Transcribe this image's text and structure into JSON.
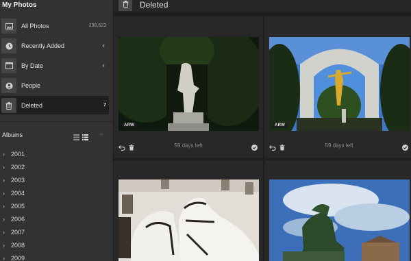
{
  "sidebar": {
    "title": "My Photos",
    "nav": [
      {
        "label": "All Photos",
        "count": "298,623",
        "icon": "image-icon"
      },
      {
        "label": "Recently Added",
        "count": "",
        "icon": "clock-icon"
      },
      {
        "label": "By Date",
        "count": "",
        "icon": "calendar-icon"
      },
      {
        "label": "People",
        "count": "",
        "icon": "person-icon"
      },
      {
        "label": "Deleted",
        "count": "7",
        "icon": "trash-icon"
      }
    ],
    "albums_title": "Albums",
    "years": [
      "2001",
      "2002",
      "2003",
      "2004",
      "2005",
      "2006",
      "2007",
      "2008",
      "2009"
    ]
  },
  "toolbar": {
    "title": "Deleted"
  },
  "photos": [
    {
      "format": "ARW",
      "days_left": "59 days left"
    },
    {
      "format": "ARW",
      "days_left": "59 days left"
    },
    {
      "format": "",
      "days_left": ""
    },
    {
      "format": "",
      "days_left": ""
    }
  ],
  "colors": {
    "sidebar_bg": "#323232",
    "active_bg": "#1f1f1f",
    "main_bg": "#1e1e1e",
    "cell_bg": "#282828"
  }
}
